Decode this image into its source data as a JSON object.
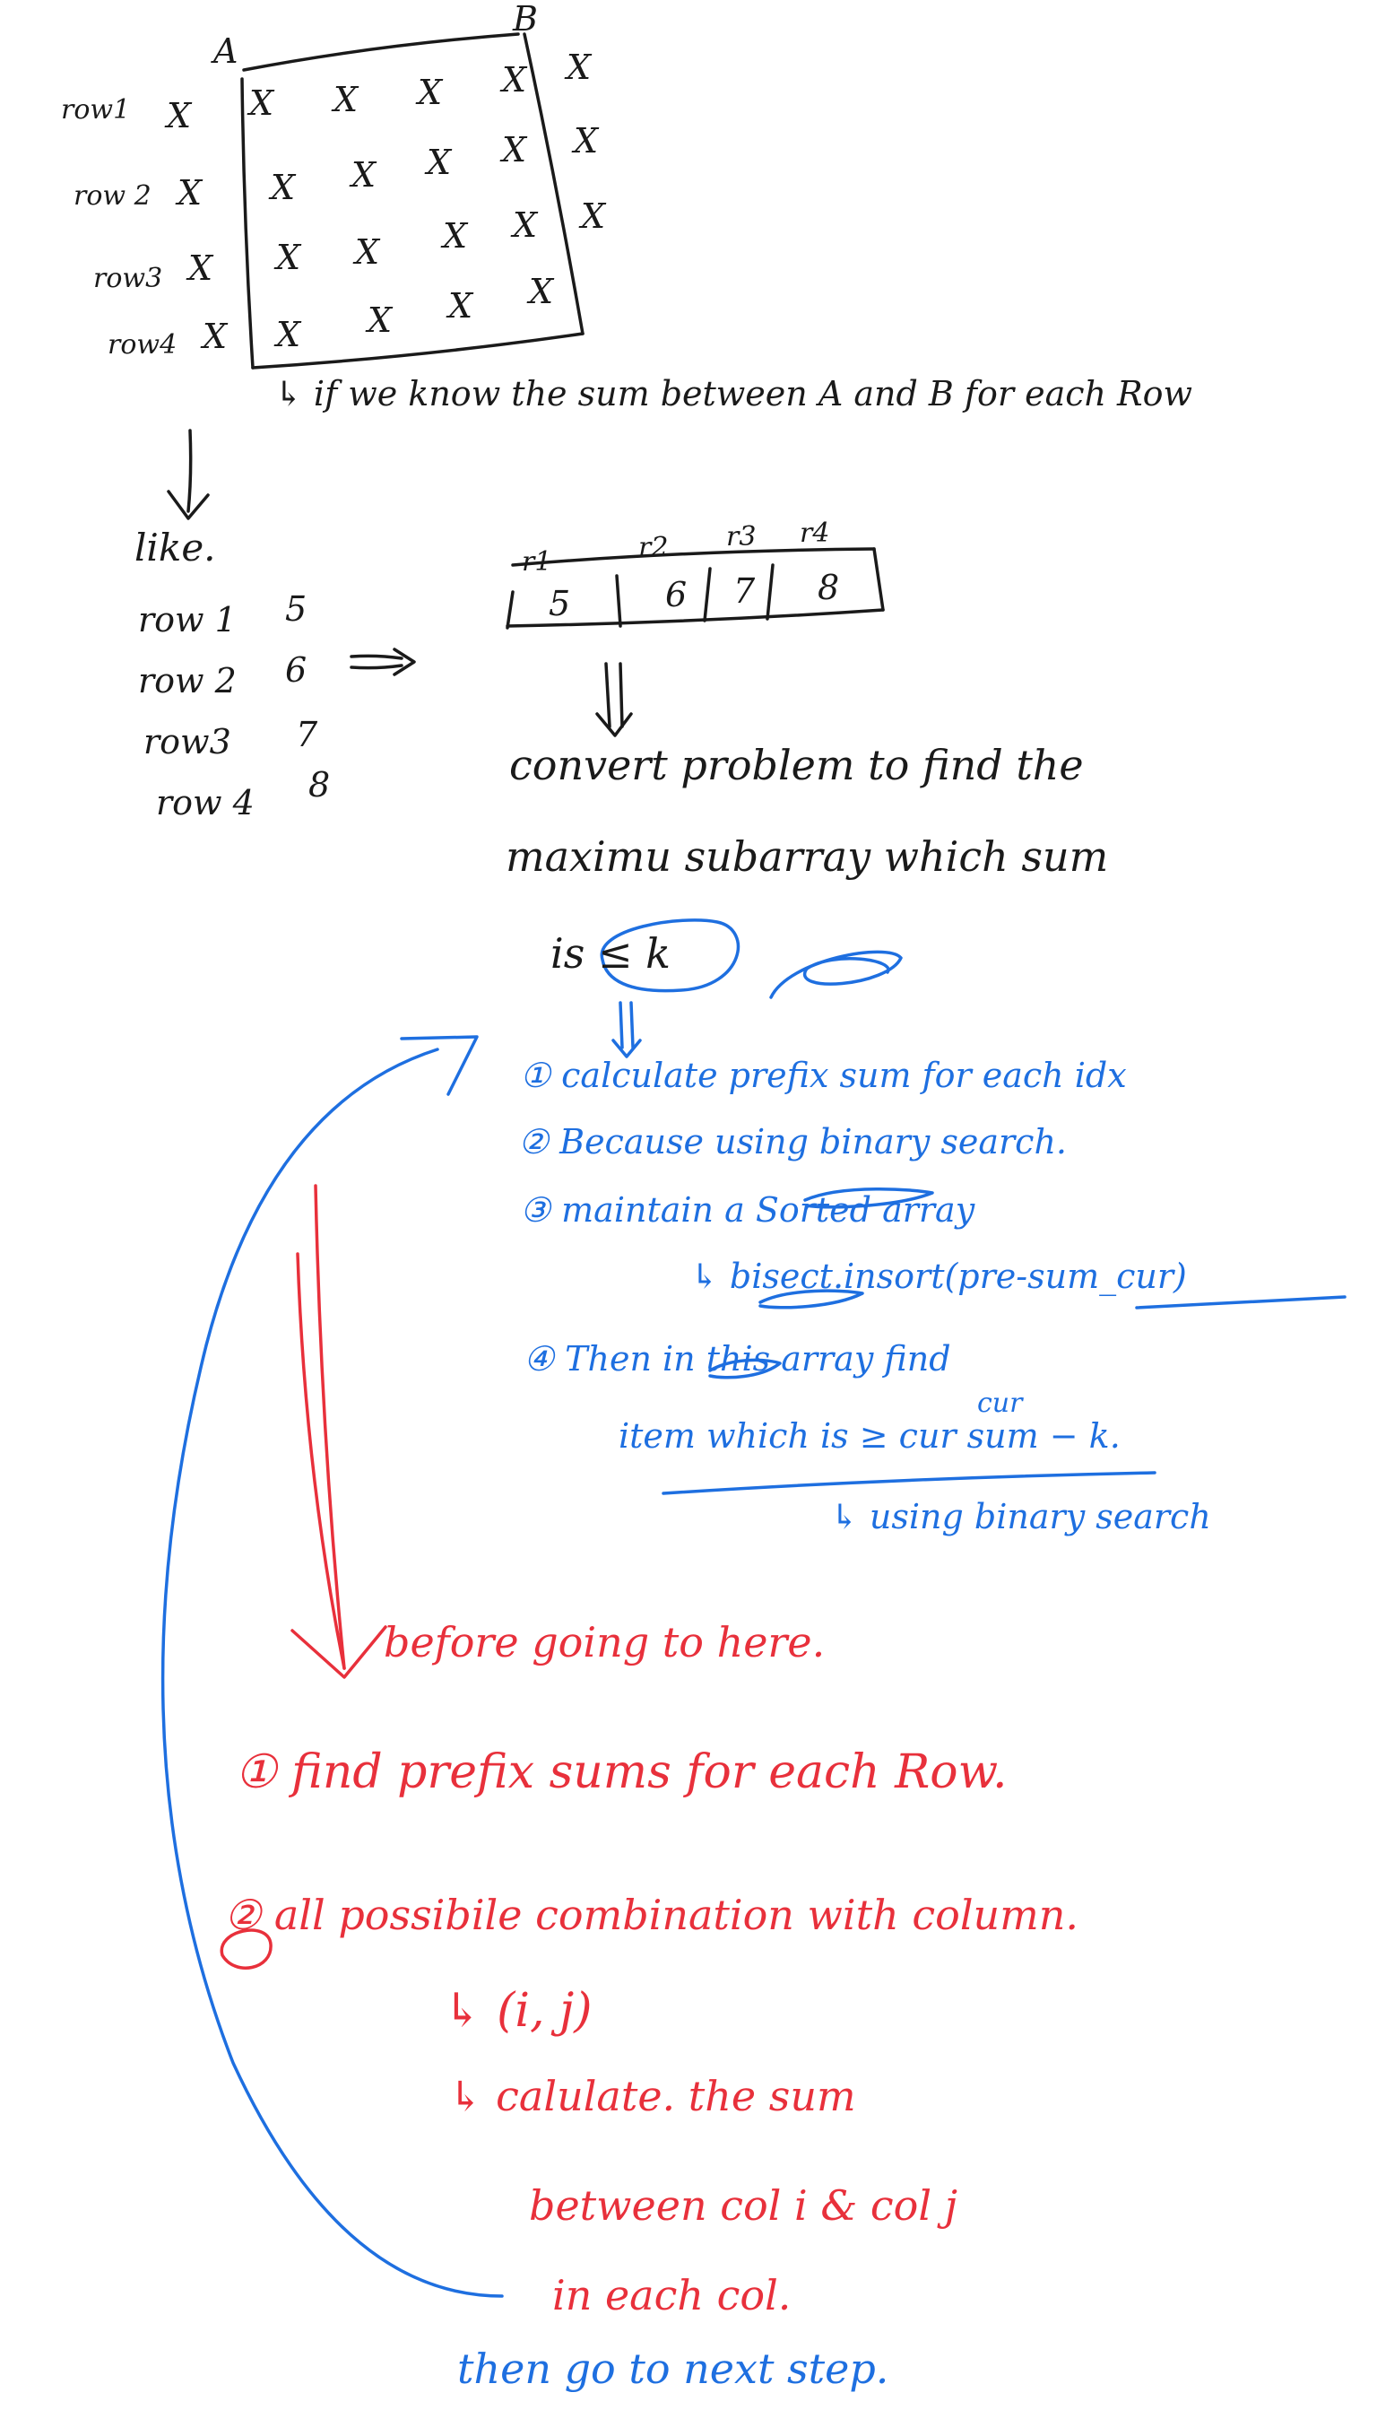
{
  "colors": {
    "ink_black": "#1a1a1a",
    "ink_blue": "#1e6fe0",
    "ink_red": "#e8303b",
    "background": "#ffffff"
  },
  "corners": {
    "a": "A",
    "b": "B"
  },
  "matrix_rows": [
    {
      "label": "row1",
      "left_mark": "X"
    },
    {
      "label": "row 2",
      "left_mark": "X"
    },
    {
      "label": "row3",
      "left_mark": "X"
    },
    {
      "label": "row4",
      "left_mark": "X"
    }
  ],
  "matrix_cell_mark": "X",
  "note_top": "↳ if we know the sum between A and B for each Row",
  "like_section": {
    "title": "like.",
    "rows": [
      {
        "label": "row 1",
        "value": "5"
      },
      {
        "label": "row 2",
        "value": "6"
      },
      {
        "label": "row3",
        "value": "7"
      },
      {
        "label": "row 4",
        "value": "8"
      }
    ]
  },
  "array": {
    "headers": [
      "r1",
      "r2",
      "r3",
      "r4"
    ],
    "values": [
      "5",
      "6",
      "7",
      "8"
    ]
  },
  "convert_lines": [
    "convert problem to find the",
    "maximu subarray which sum",
    "is ≤ k"
  ],
  "blue_steps": [
    "① calculate prefix sum for each idx",
    "② Because using binary search.",
    "③ maintain a Sorted array",
    "↳ bisect.insort(pre-sum_cur)",
    "④ Then in this array find",
    "item which is ≥ cur sum − k.",
    "↳ using binary search"
  ],
  "blue_super": "cur",
  "red_notes": [
    "before going to here.",
    "① find prefix sums for each Row.",
    "② all possibile combination with column.",
    "↳ (i, j)",
    "↳ calulate. the sum",
    "between col i & col j",
    "in each col."
  ],
  "blue_final": "then go to next step."
}
